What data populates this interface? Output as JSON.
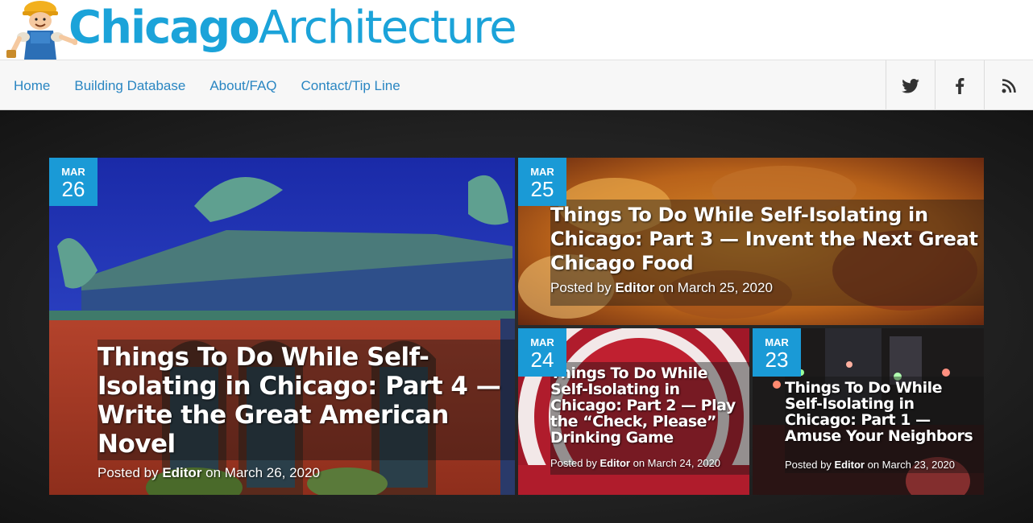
{
  "site": {
    "logo_bold": "Chicago",
    "logo_light": "Architecture"
  },
  "nav": {
    "items": [
      {
        "label": "Home"
      },
      {
        "label": "Building Database"
      },
      {
        "label": "About/FAQ"
      },
      {
        "label": "Contact/Tip Line"
      }
    ],
    "social": [
      "twitter-icon",
      "facebook-icon",
      "rss-icon"
    ]
  },
  "colors": {
    "accent": "#1a9ad6",
    "logo": "#1ba3d9",
    "nav_link": "#2a86c2"
  },
  "posts": [
    {
      "month": "MAR",
      "day": "26",
      "title": "Things To Do While Self-Isolating in Chicago: Part 4 — Write the Great American Novel",
      "byline_prefix": "Posted by ",
      "author": "Editor",
      "byline_suffix": " on March 26, 2020"
    },
    {
      "month": "MAR",
      "day": "25",
      "title": "Things To Do While Self-Isolating in Chicago: Part 3 — Invent the Next Great Chicago Food",
      "byline_prefix": "Posted by ",
      "author": "Editor",
      "byline_suffix": " on March 25, 2020"
    },
    {
      "month": "MAR",
      "day": "24",
      "title": "Things To Do While Self-Isolating in Chicago: Part 2 — Play the “Check, Please” Drinking Game",
      "byline_prefix": "Posted by ",
      "author": "Editor",
      "byline_suffix": " on March 24, 2020"
    },
    {
      "month": "MAR",
      "day": "23",
      "title": "Things To Do While Self-Isolating in Chicago: Part 1 — Amuse Your Neighbors",
      "byline_prefix": "Posted by ",
      "author": "Editor",
      "byline_suffix": " on March 23, 2020"
    }
  ]
}
